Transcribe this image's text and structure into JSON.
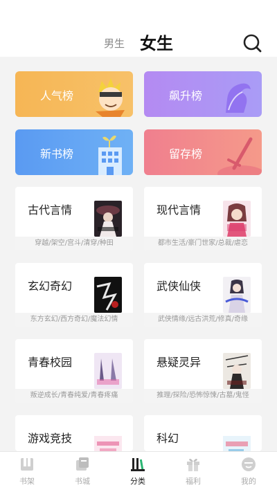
{
  "header": {
    "gender_male": "男生",
    "gender_female": "女生"
  },
  "rankings": [
    {
      "label": "人气榜",
      "color": "#f6b655"
    },
    {
      "label": "飙升榜",
      "color": "#b48af2"
    },
    {
      "label": "新书榜",
      "color": "#5a9af2"
    },
    {
      "label": "留存榜",
      "color": "#f07f8e"
    }
  ],
  "categories": [
    {
      "title": "古代言情",
      "tags": "穿越/架空/宫斗/清穿/种田"
    },
    {
      "title": "现代言情",
      "tags": "都市生活/豪门世家/总裁/虐恋"
    },
    {
      "title": "玄幻奇幻",
      "tags": "东方玄幻/西方奇幻/魔法幻情"
    },
    {
      "title": "武侠仙侠",
      "tags": "武侠情缘/远古洪荒/修真/奇缘"
    },
    {
      "title": "青春校园",
      "tags": "叛逆成长/青春纯爱/青春疼痛"
    },
    {
      "title": "悬疑灵异",
      "tags": "推理/探险/恐怖惊悚/古墓/鬼怪"
    },
    {
      "title": "游戏竞技",
      "tags": ""
    },
    {
      "title": "科幻",
      "tags": ""
    }
  ],
  "tabbar": [
    {
      "label": "书架",
      "icon": "bookshelf-icon"
    },
    {
      "label": "书城",
      "icon": "bookstore-icon"
    },
    {
      "label": "分类",
      "icon": "category-icon",
      "active": true
    },
    {
      "label": "福利",
      "icon": "gift-icon"
    },
    {
      "label": "我的",
      "icon": "profile-icon"
    }
  ]
}
